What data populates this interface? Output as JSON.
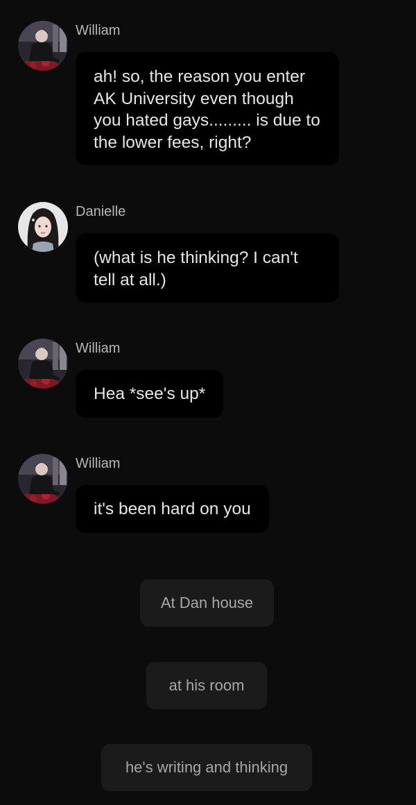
{
  "messages": [
    {
      "sender": "William",
      "avatar_icon": "william-avatar-icon",
      "text": "ah! so, the reason you enter AK University even though you hated gays......... is due to the lower fees, right?"
    },
    {
      "sender": "Danielle",
      "avatar_icon": "danielle-avatar-icon",
      "text": "(what is he thinking? I can't tell at all.)"
    },
    {
      "sender": "William",
      "avatar_icon": "william-avatar-icon",
      "text": "Hea *see's up*"
    },
    {
      "sender": "William",
      "avatar_icon": "william-avatar-icon",
      "text": "it's been hard on you"
    }
  ],
  "options": [
    {
      "label": "At Dan house"
    },
    {
      "label": "at his room"
    },
    {
      "label": "he's writing and thinking"
    }
  ],
  "colors": {
    "background": "#0c0c0c",
    "bubble": "#000000",
    "option": "#1b1b1b",
    "name_text": "#b8b8b8",
    "message_text": "#e6e6e6",
    "option_text": "#a8a8a8"
  }
}
